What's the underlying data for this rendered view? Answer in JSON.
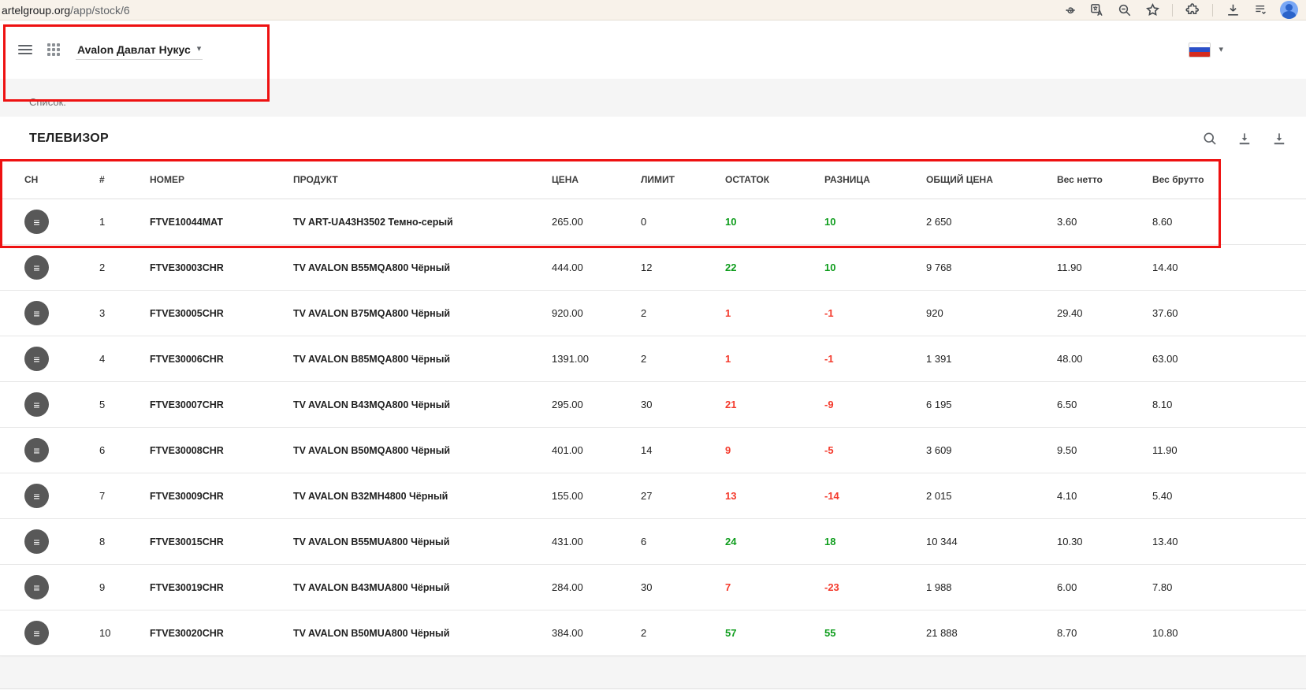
{
  "colors": {
    "pos": "#0f9d1d",
    "neg": "#f43a2c",
    "annotation": "#ee1111",
    "icon": "#5f6368"
  },
  "browser": {
    "url_domain": "artelgroup.org",
    "url_path": "/app/stock/6",
    "icons": [
      "key-icon",
      "translate-icon",
      "zoom-icon",
      "star-icon",
      "extensions-icon",
      "download-icon",
      "reading-list-icon",
      "profile-avatar"
    ]
  },
  "appbar": {
    "company": "Avalon Давлат Нукус",
    "language_flag": "ru"
  },
  "page": {
    "list_label": "Список:",
    "card_title": "ТЕЛЕВИЗОР",
    "card_icons": [
      "search-icon",
      "download-icon",
      "download-icon"
    ]
  },
  "table": {
    "columns": [
      "СН",
      "#",
      "НОМЕР",
      "ПРОДУКТ",
      "ЦЕНА",
      "ЛИМИТ",
      "ОСТАТОК",
      "РАЗНИЦА",
      "ОБЩИЙ ЦЕНА",
      "Вес нетто",
      "Вес брутто"
    ],
    "rows": [
      {
        "num": "1",
        "code": "FTVE10044MAT",
        "product": "TV ART-UA43H3502 Темно-серый",
        "price": "265.00",
        "limit": "0",
        "stock": "10",
        "diff": "10",
        "total": "2 650",
        "net": "3.60",
        "gross": "8.60",
        "trend": "up"
      },
      {
        "num": "2",
        "code": "FTVE30003CHR",
        "product": "TV AVALON B55MQA800 Чёрный",
        "price": "444.00",
        "limit": "12",
        "stock": "22",
        "diff": "10",
        "total": "9 768",
        "net": "11.90",
        "gross": "14.40",
        "trend": "up"
      },
      {
        "num": "3",
        "code": "FTVE30005CHR",
        "product": "TV AVALON B75MQA800 Чёрный",
        "price": "920.00",
        "limit": "2",
        "stock": "1",
        "diff": "-1",
        "total": "920",
        "net": "29.40",
        "gross": "37.60",
        "trend": "down"
      },
      {
        "num": "4",
        "code": "FTVE30006CHR",
        "product": "TV AVALON B85MQA800 Чёрный",
        "price": "1391.00",
        "limit": "2",
        "stock": "1",
        "diff": "-1",
        "total": "1 391",
        "net": "48.00",
        "gross": "63.00",
        "trend": "down"
      },
      {
        "num": "5",
        "code": "FTVE30007CHR",
        "product": "TV AVALON B43MQA800 Чёрный",
        "price": "295.00",
        "limit": "30",
        "stock": "21",
        "diff": "-9",
        "total": "6 195",
        "net": "6.50",
        "gross": "8.10",
        "trend": "down"
      },
      {
        "num": "6",
        "code": "FTVE30008CHR",
        "product": "TV AVALON B50MQA800 Чёрный",
        "price": "401.00",
        "limit": "14",
        "stock": "9",
        "diff": "-5",
        "total": "3 609",
        "net": "9.50",
        "gross": "11.90",
        "trend": "down"
      },
      {
        "num": "7",
        "code": "FTVE30009CHR",
        "product": "TV AVALON B32MH4800 Чёрный",
        "price": "155.00",
        "limit": "27",
        "stock": "13",
        "diff": "-14",
        "total": "2 015",
        "net": "4.10",
        "gross": "5.40",
        "trend": "down"
      },
      {
        "num": "8",
        "code": "FTVE30015CHR",
        "product": "TV AVALON B55MUA800 Чёрный",
        "price": "431.00",
        "limit": "6",
        "stock": "24",
        "diff": "18",
        "total": "10 344",
        "net": "10.30",
        "gross": "13.40",
        "trend": "up"
      },
      {
        "num": "9",
        "code": "FTVE30019CHR",
        "product": "TV AVALON B43MUA800 Чёрный",
        "price": "284.00",
        "limit": "30",
        "stock": "7",
        "diff": "-23",
        "total": "1 988",
        "net": "6.00",
        "gross": "7.80",
        "trend": "down"
      },
      {
        "num": "10",
        "code": "FTVE30020CHR",
        "product": "TV AVALON B50MUA800 Чёрный",
        "price": "384.00",
        "limit": "2",
        "stock": "57",
        "diff": "55",
        "total": "21 888",
        "net": "8.70",
        "gross": "10.80",
        "trend": "up"
      }
    ]
  }
}
